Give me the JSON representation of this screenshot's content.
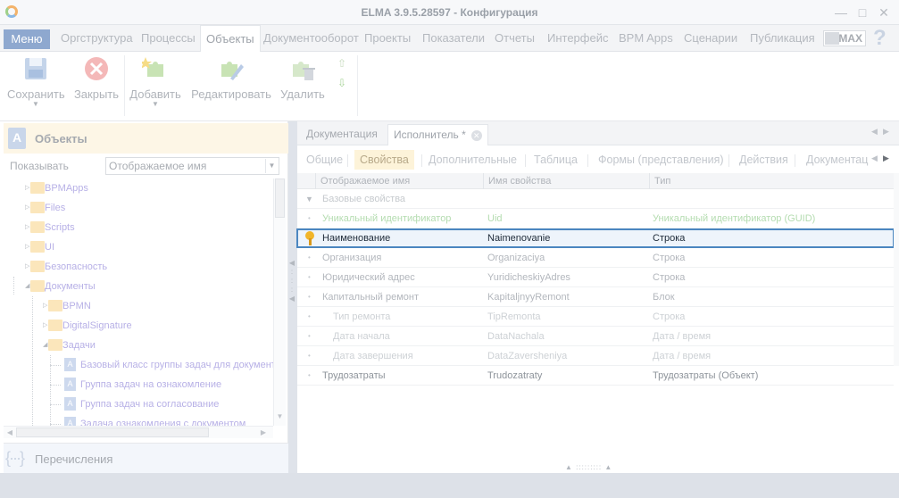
{
  "window": {
    "title": "ELMA 3.9.5.28597 - Конфигурация"
  },
  "menubar": {
    "menu_label": "Меню",
    "tabs": [
      {
        "label": "Оргструктура",
        "active": false
      },
      {
        "label": "Процессы",
        "active": false
      },
      {
        "label": "Объекты",
        "active": true
      },
      {
        "label": "Документооборот",
        "active": false
      },
      {
        "label": "Проекты",
        "active": false
      },
      {
        "label": "Показатели",
        "active": false
      },
      {
        "label": "Отчеты",
        "active": false
      },
      {
        "label": "Интерфейс",
        "active": false
      },
      {
        "label": "BPM Apps",
        "active": false
      },
      {
        "label": "Сценарии",
        "active": false
      },
      {
        "label": "Публикация",
        "active": false
      }
    ],
    "max_label": "MAX",
    "help_glyph": "?"
  },
  "ribbon": {
    "save": "Сохранить",
    "close": "Закрыть",
    "add": "Добавить",
    "edit": "Редактировать",
    "delete": "Удалить"
  },
  "left_panel": {
    "title": "Объекты",
    "show_label": "Показывать",
    "show_value": "Отображаемое имя",
    "tree": [
      {
        "label": "BPMApps",
        "kind": "folder",
        "level": 0
      },
      {
        "label": "Files",
        "kind": "folder",
        "level": 0
      },
      {
        "label": "Scripts",
        "kind": "folder",
        "level": 0
      },
      {
        "label": "UI",
        "kind": "folder",
        "level": 0
      },
      {
        "label": "Безопасность",
        "kind": "folder",
        "level": 0
      },
      {
        "label": "Документы",
        "kind": "folder",
        "level": 0,
        "expanded": true
      },
      {
        "label": "BPMN",
        "kind": "folder",
        "level": 1
      },
      {
        "label": "DigitalSignature",
        "kind": "folder",
        "level": 1
      },
      {
        "label": "Задачи",
        "kind": "folder",
        "level": 1,
        "expanded": true
      },
      {
        "label": "Базовый класс группы задач для документ",
        "kind": "object",
        "level": 2
      },
      {
        "label": "Группа задач на ознакомление",
        "kind": "object",
        "level": 2
      },
      {
        "label": "Группа задач на согласование",
        "kind": "object",
        "level": 2
      },
      {
        "label": "Задача ознакомления с документом",
        "kind": "object",
        "level": 2
      }
    ],
    "footer_label": "Перечисления"
  },
  "right_panel": {
    "doc_tabs": [
      {
        "label": "Документация",
        "active": false
      },
      {
        "label": "Исполнитель *",
        "active": true
      }
    ],
    "sub_tabs": [
      {
        "label": "Общие",
        "active": false
      },
      {
        "label": "Свойства",
        "active": true
      },
      {
        "label": "Дополнительные",
        "active": false
      },
      {
        "label": "Таблица",
        "active": false
      },
      {
        "label": "Формы (представления)",
        "active": false
      },
      {
        "label": "Действия",
        "active": false
      },
      {
        "label": "Документац",
        "active": false
      }
    ],
    "grid": {
      "columns": [
        "Отображаемое имя",
        "Имя свойства",
        "Тип"
      ],
      "group_label": "Базовые свойства",
      "rows": [
        {
          "name": "Уникальный идентификатор",
          "prop": "Uid",
          "type": "Уникальный идентификатор (GUID)",
          "style": "uid"
        },
        {
          "name": "Наименование",
          "prop": "Naimenovanie",
          "type": "Строка",
          "style": "sel"
        },
        {
          "name": "Организация",
          "prop": "Organizaciya",
          "type": "Строка",
          "style": "normal"
        },
        {
          "name": "Юридический адрес",
          "prop": "YuridicheskiyAdres",
          "type": "Строка",
          "style": "normal"
        },
        {
          "name": "Капитальный ремонт",
          "prop": "KapitaljnyyRemont",
          "type": "Блок",
          "style": "normal"
        },
        {
          "name": "Тип ремонта",
          "prop": "TipRemonta",
          "type": "Строка",
          "style": "child"
        },
        {
          "name": "Дата начала",
          "prop": "DataNachala",
          "type": "Дата / время",
          "style": "child"
        },
        {
          "name": "Дата завершения",
          "prop": "DataZaversheniya",
          "type": "Дата / время",
          "style": "child"
        },
        {
          "name": "Трудозатраты",
          "prop": "Trudozatraty",
          "type": "Трудозатраты (Объект)",
          "style": "normal"
        }
      ]
    }
  }
}
